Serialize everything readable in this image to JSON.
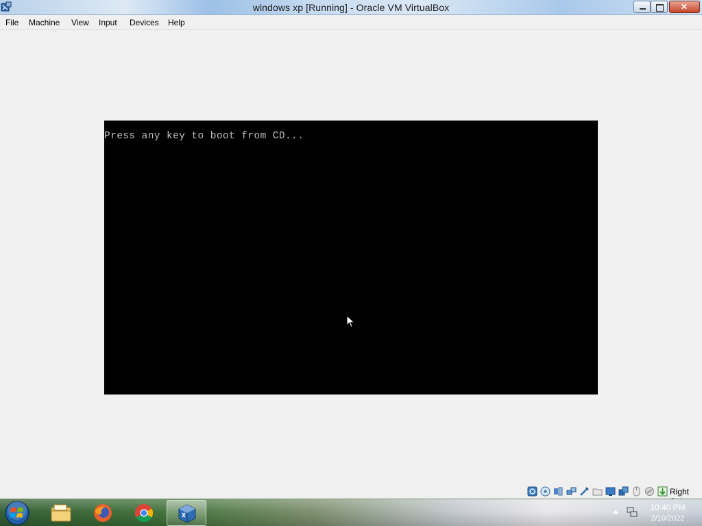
{
  "window": {
    "title": "windows xp [Running] - Oracle VM VirtualBox"
  },
  "menu": {
    "items": [
      "File",
      "Machine",
      "View",
      "Input",
      "Devices",
      "Help"
    ]
  },
  "vm": {
    "console_text": "Press any key to boot from CD..."
  },
  "statusbar": {
    "icons": [
      "hard-disk-icon",
      "optical-drive-icon",
      "audio-icon",
      "network-icon",
      "usb-icon",
      "shared-folders-icon",
      "display-icon",
      "video-capture-icon",
      "mouse-integration-icon",
      "cpu-icon",
      "keyboard-capture-icon"
    ],
    "host_key": "Right Ctrl"
  },
  "taskbar": {
    "apps": [
      "windows-explorer-icon",
      "firefox-icon",
      "chrome-icon",
      "virtualbox-icon"
    ],
    "clock_time": "10:40 PM",
    "clock_date": "2/10/2022"
  },
  "colors": {
    "vm_background": "#000000",
    "console_text": "#c0c0c0",
    "window_background": "#f0f0f0"
  }
}
